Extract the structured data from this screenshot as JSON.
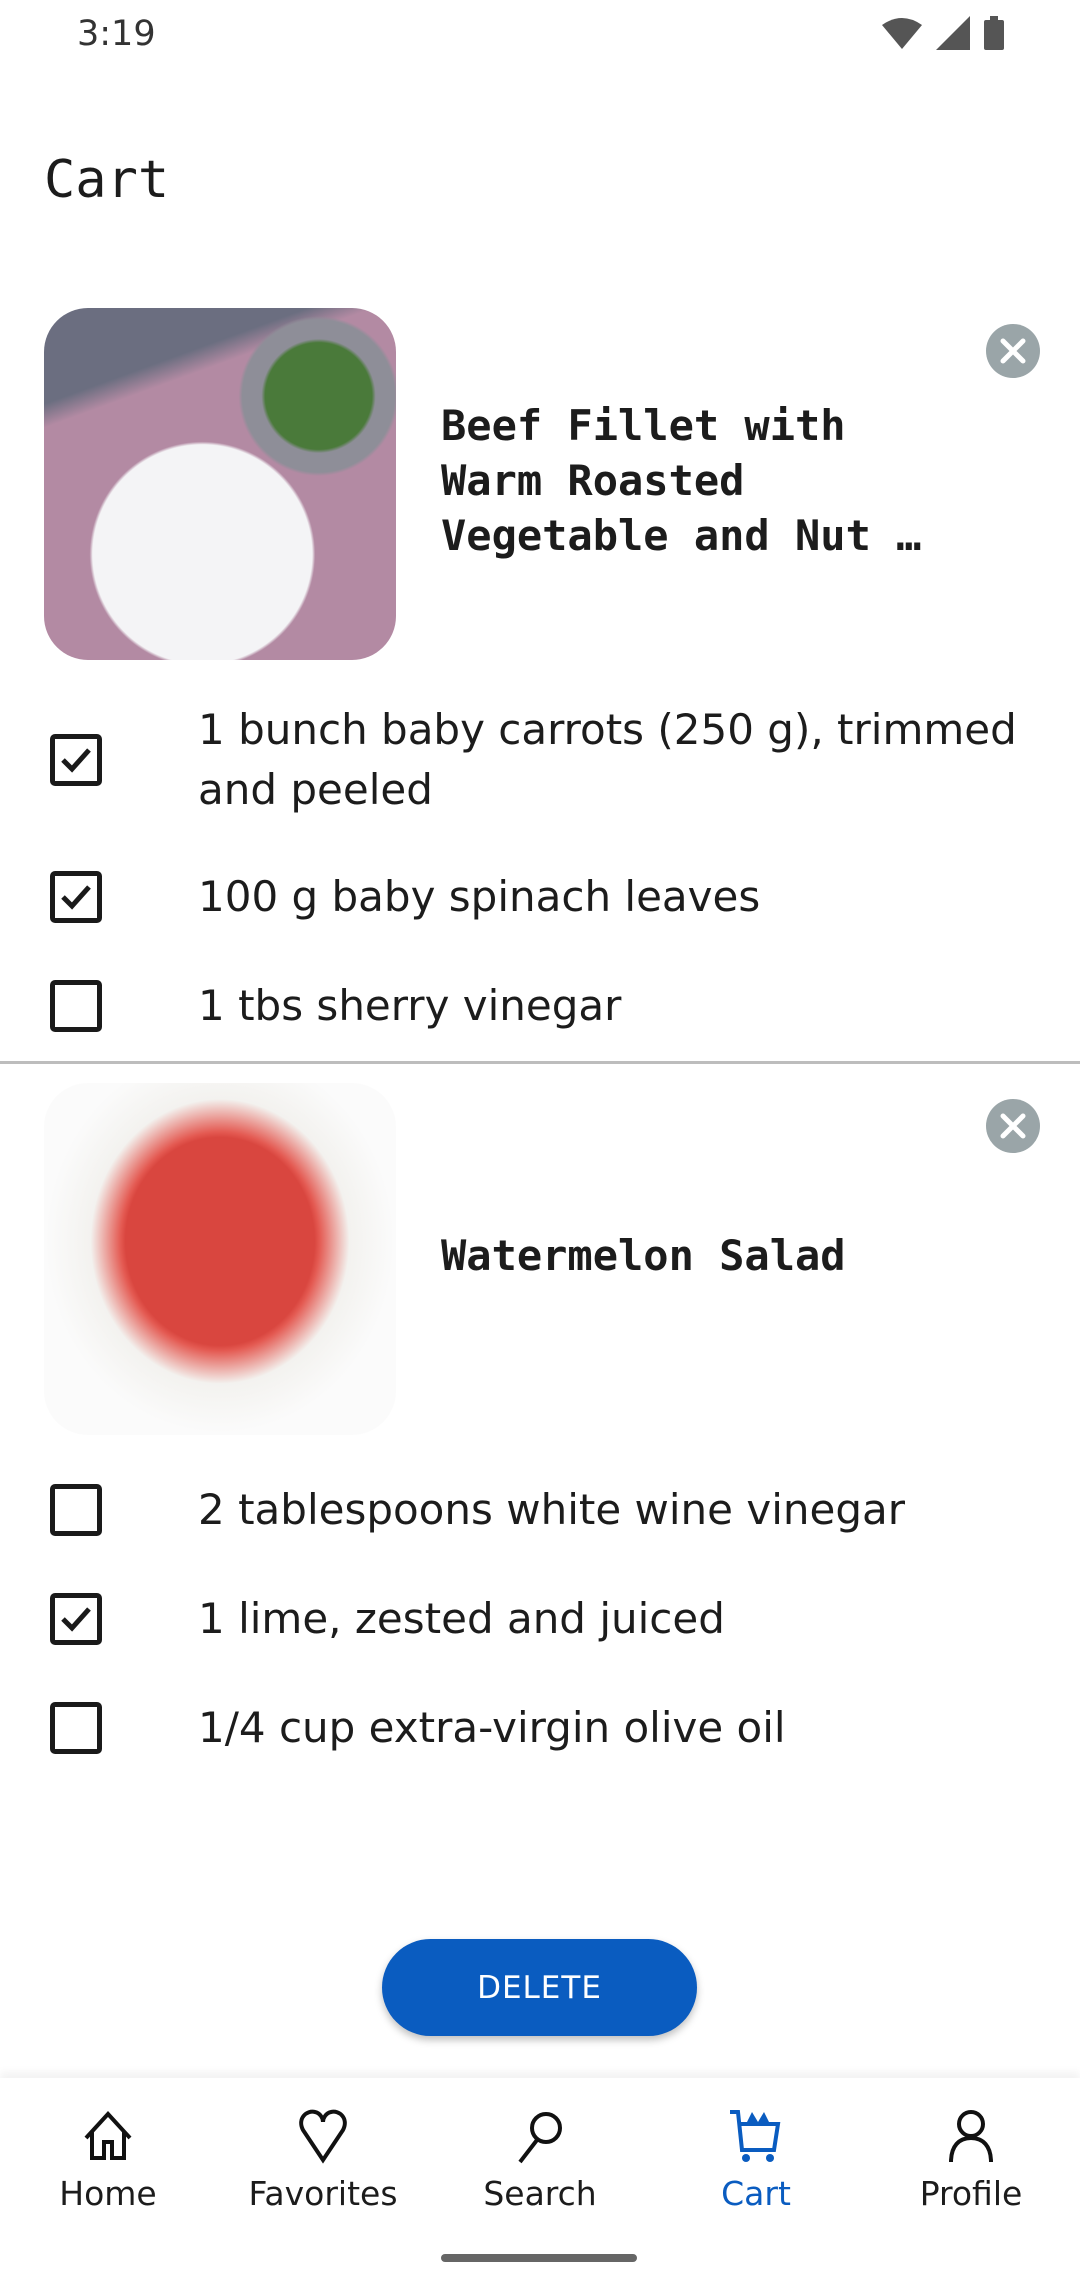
{
  "status_bar": {
    "time": "3:19"
  },
  "page": {
    "title": "Cart"
  },
  "recipes": [
    {
      "title": "Beef Fillet with Warm Roasted Vegetable and Nut …",
      "ingredients": [
        {
          "text": "1 bunch baby carrots (250 g), trimmed and peeled",
          "checked": true
        },
        {
          "text": "100 g baby spinach leaves",
          "checked": true
        },
        {
          "text": "1 tbs sherry vinegar",
          "checked": false
        }
      ]
    },
    {
      "title": "Watermelon Salad",
      "ingredients": [
        {
          "text": "2 tablespoons white wine vinegar",
          "checked": false
        },
        {
          "text": "1 lime, zested and juiced",
          "checked": true
        },
        {
          "text": "1/4 cup extra-virgin olive oil",
          "checked": false
        }
      ]
    }
  ],
  "delete_label": "DELETE",
  "nav": [
    {
      "label": "Home",
      "icon": "home-icon"
    },
    {
      "label": "Favorites",
      "icon": "heart-icon"
    },
    {
      "label": "Search",
      "icon": "search-icon"
    },
    {
      "label": "Cart",
      "icon": "cart-icon",
      "active": true
    },
    {
      "label": "Profile",
      "icon": "profile-icon"
    }
  ],
  "colors": {
    "accent": "#0a5cc0",
    "close": "#9aa5a8"
  }
}
